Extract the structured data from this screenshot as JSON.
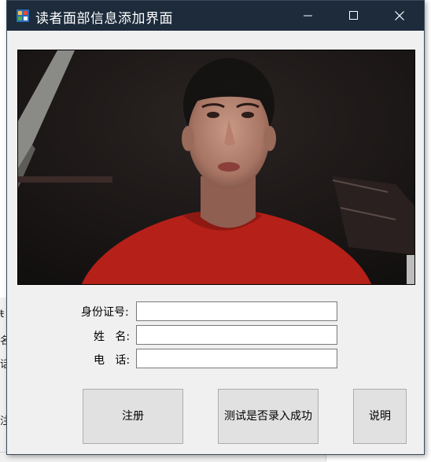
{
  "window": {
    "title": "读者面部信息添加界面"
  },
  "form": {
    "id_label": "身份证号:",
    "name_label": "姓   名:",
    "phone_label": "电   话:",
    "id_value": "",
    "name_value": "",
    "phone_value": ""
  },
  "buttons": {
    "register": "注册",
    "test_enrolled": "测试是否录入成功",
    "help": "说明"
  },
  "background": {
    "frag_1": "ŧ",
    "frag_2": "名",
    "frag_3": "话",
    "frag_4": "注"
  },
  "colors": {
    "titlebar": "#1d2b3b",
    "window_bg": "#f0f0f0",
    "button_bg": "#e1e1e1"
  },
  "icons": [
    "app-icon",
    "minimize-icon",
    "maximize-icon",
    "close-icon"
  ]
}
